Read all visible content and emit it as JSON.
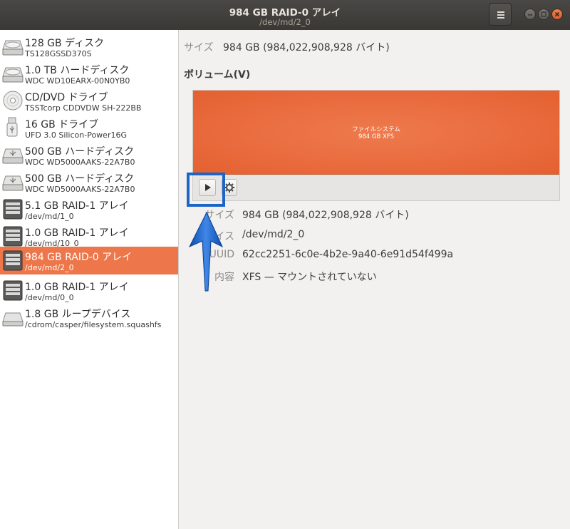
{
  "window": {
    "title": "984 GB RAID-0 アレイ",
    "subtitle": "/dev/md/2_0"
  },
  "sidebar": {
    "devices": [
      {
        "name": "128 GB ディスク",
        "sub": "TS128GSSD370S",
        "icon": "harddisk-icon"
      },
      {
        "name": "1.0 TB ハードディスク",
        "sub": "WDC WD10EARX-00N0YB0",
        "icon": "harddisk-icon"
      },
      {
        "name": "CD/DVD ドライブ",
        "sub": "TSSTcorp CDDVDW SH-222BB",
        "icon": "optical-disc-icon"
      },
      {
        "name": "16 GB ドライブ",
        "sub": "UFD 3.0 Silicon-Power16G",
        "icon": "usb-stick-icon"
      },
      {
        "name": "500 GB ハードディスク",
        "sub": "WDC WD5000AAKS-22A7B0",
        "icon": "usb-harddisk-icon"
      },
      {
        "name": "500 GB ハードディスク",
        "sub": "WDC WD5000AAKS-22A7B0",
        "icon": "usb-harddisk-icon"
      },
      {
        "name": "5.1 GB RAID-1 アレイ",
        "sub": "/dev/md/1_0",
        "icon": "raid-array-icon"
      },
      {
        "name": "1.0 GB RAID-1 アレイ",
        "sub": "/dev/md/10_0",
        "icon": "raid-array-icon"
      },
      {
        "name": "984 GB RAID-0 アレイ",
        "sub": "/dev/md/2_0",
        "icon": "raid-array-icon",
        "selected": true
      },
      {
        "name": "1.0 GB RAID-1 アレイ",
        "sub": "/dev/md/0_0",
        "icon": "raid-array-icon"
      },
      {
        "name": "1.8 GB ループデバイス",
        "sub": "/cdrom/casper/filesystem.squashfs",
        "icon": "loop-device-icon"
      }
    ]
  },
  "main": {
    "size_label": "サイズ",
    "size_value": "984 GB (984,022,908,928 バイト)",
    "volumes_heading": "ボリューム(V)",
    "partition": {
      "line1": "ファイルシステム",
      "line2": "984 GB XFS"
    },
    "details": {
      "size_label": "サイズ",
      "size_value": "984 GB (984,022,908,928 バイト)",
      "device_label": "デバイス",
      "device_value": "/dev/md/2_0",
      "uuid_label": "UUID",
      "uuid_value": "62cc2251-6c0e-4b2e-9a40-6e91d54f499a",
      "contents_label": "内容",
      "contents_value": "XFS — マウントされていない"
    }
  },
  "colors": {
    "accent": "#ed764a",
    "highlight": "#1c64c7"
  }
}
